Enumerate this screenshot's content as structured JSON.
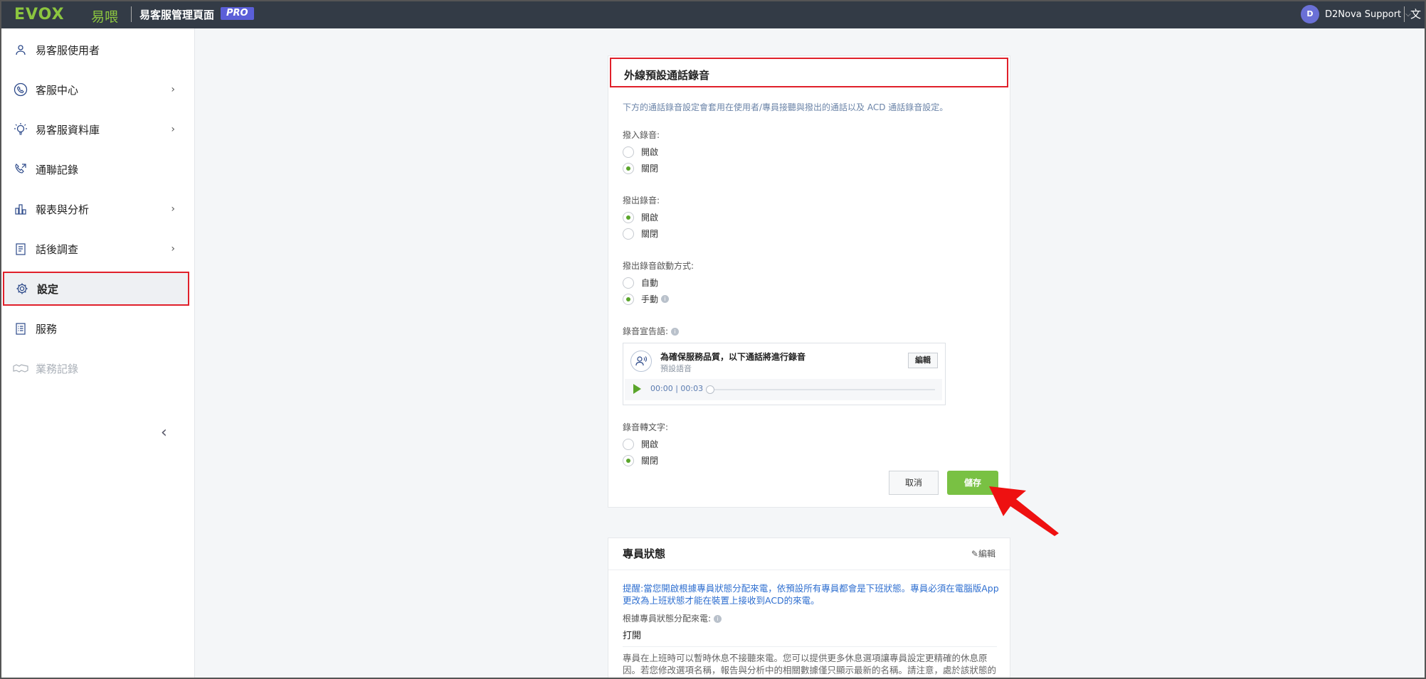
{
  "topbar": {
    "logo": "EVOX",
    "logo_cn": "易喂",
    "title": "易客服管理頁面",
    "badge": "PRO",
    "user_initial": "D",
    "user_name": "D2Nova Support",
    "lang": "文"
  },
  "sidebar": {
    "items": [
      {
        "label": "易客服使用者",
        "icon": "user-icon"
      },
      {
        "label": "客服中心",
        "icon": "call-center-icon"
      },
      {
        "label": "易客服資料庫",
        "icon": "lightbulb-icon"
      },
      {
        "label": "通聯記錄",
        "icon": "phone-log-icon"
      },
      {
        "label": "報表與分析",
        "icon": "chart-icon"
      },
      {
        "label": "話後調查",
        "icon": "survey-icon"
      },
      {
        "label": "設定",
        "icon": "gear-icon"
      },
      {
        "label": "服務",
        "icon": "service-list-icon"
      },
      {
        "label": "業務記錄",
        "icon": "handshake-icon"
      }
    ],
    "active": "設定"
  },
  "recording": {
    "title": "外線預設通話錄音",
    "description": "下方的通話錄音設定會套用在使用者/專員接聽與撥出的通話以及 ACD 通話錄音設定。",
    "inbound_label": "撥入錄音:",
    "outbound_label": "撥出錄音:",
    "mode_label": "撥出錄音啟動方式:",
    "on": "開啟",
    "off": "關閉",
    "auto": "自動",
    "manual": "手動",
    "announce_label": "錄音宣告語:",
    "announce_title": "為確保服務品質，以下通話將進行錄音",
    "announce_sub": "預設語音",
    "announce_edit": "編輯",
    "player_time": "00:00 | 00:03",
    "transcribe_label": "錄音轉文字:",
    "cancel": "取消",
    "save": "儲存",
    "inbound_value": "關閉",
    "outbound_value": "開啟",
    "mode_value": "手動",
    "transcribe_value": "關閉"
  },
  "agent_status": {
    "title": "專員狀態",
    "edit": "編輯",
    "notice": "提醒:當您開啟根據專員狀態分配來電，依預設所有專員都會是下班狀態。專員必須在電腦版App更改為上班狀態才能在裝置上接收到ACD的來電。",
    "assign_label": "根據專員狀態分配來電:",
    "assign_value": "打開",
    "paragraph": "專員在上班時可以暫時休息不接聽來電。您可以提供更多休息選項讓專員設定更精確的休息原因。若您修改選項名稱，報告與分析中的相關數據僅只顯示最新的名稱。請注意，處於該狀態的專員也將繼續接新的公司休息狀態。"
  },
  "colors": {
    "topbar": "#333b46",
    "accent_green": "#79c143",
    "highlight_red": "#e0202a",
    "pro_badge": "#5b5fd8"
  }
}
